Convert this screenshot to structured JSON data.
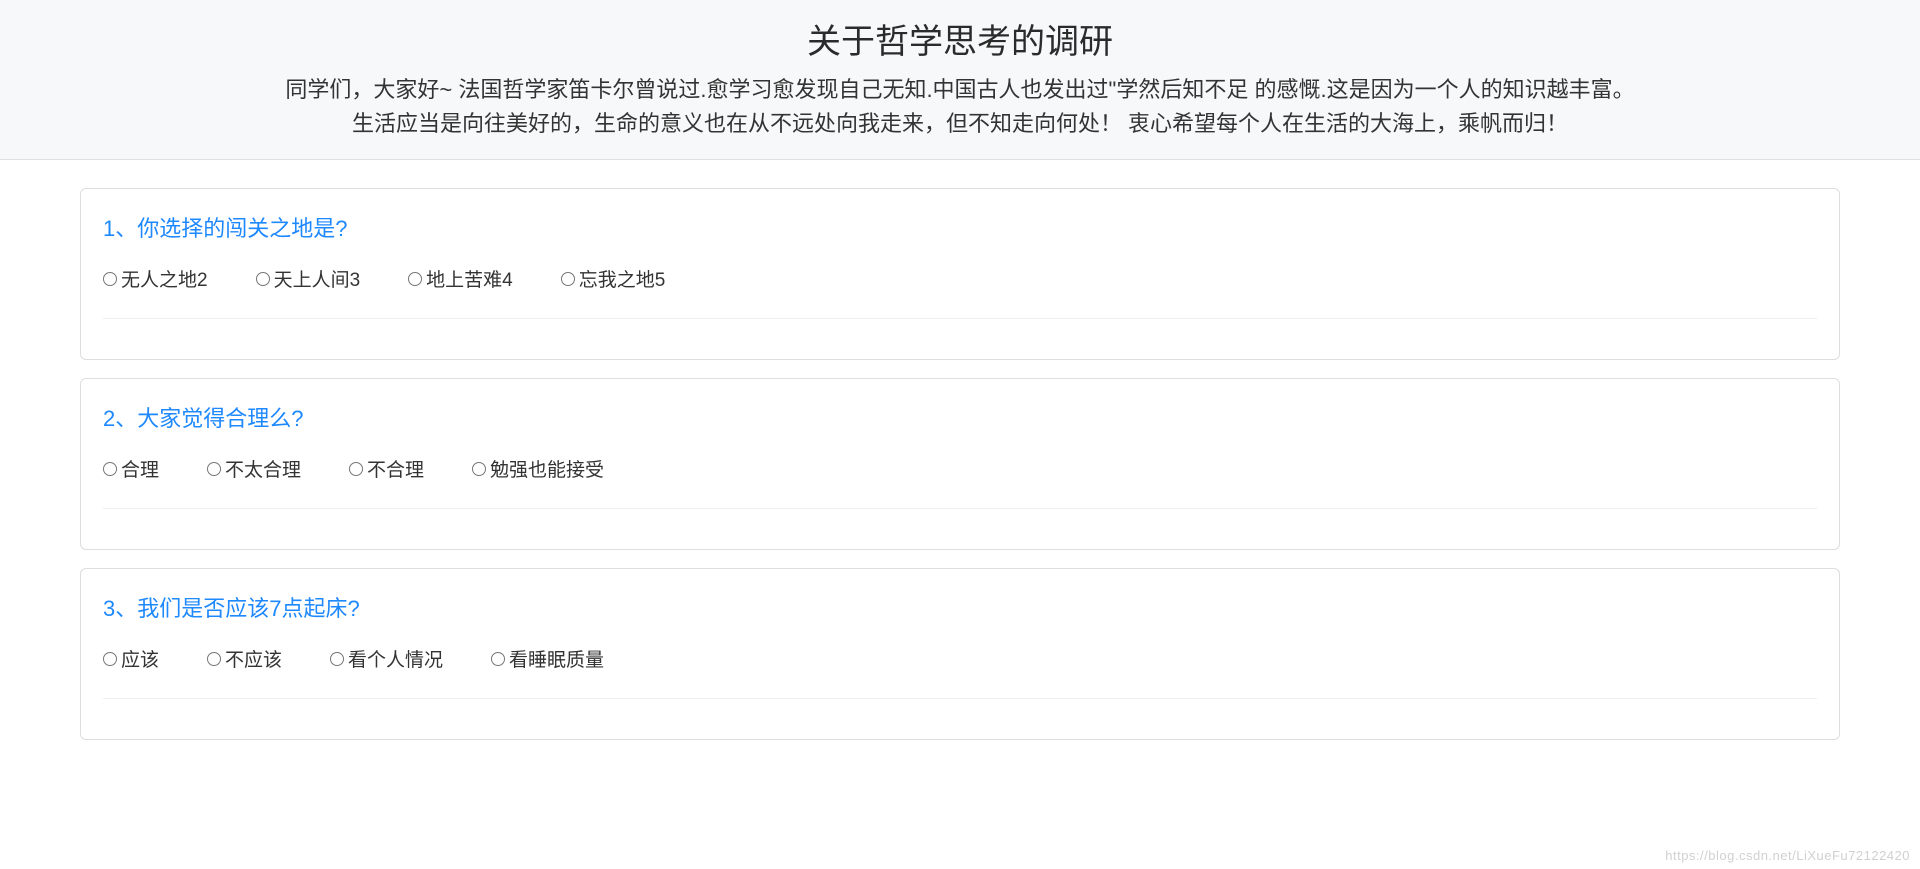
{
  "header": {
    "title": "关于哲学思考的调研",
    "description": "同学们，大家好~ 法国哲学家笛卡尔曾说过.愈学习愈发现自己无知.中国古人也发出过\"学然后知不足 的感慨.这是因为一个人的知识越丰富。 生活应当是向往美好的，生命的意义也在从不远处向我走来，但不知走向何处！ 衷心希望每个人在生活的大海上，乘帆而归！"
  },
  "questions": [
    {
      "title": "1、你选择的闯关之地是?",
      "options": [
        "无人之地2",
        "天上人间3",
        "地上苦难4",
        "忘我之地5"
      ]
    },
    {
      "title": "2、大家觉得合理么?",
      "options": [
        "合理",
        "不太合理",
        "不合理",
        "勉强也能接受"
      ]
    },
    {
      "title": "3、我们是否应该7点起床?",
      "options": [
        "应该",
        "不应该",
        "看个人情况",
        "看睡眠质量"
      ]
    }
  ],
  "watermark": "https://blog.csdn.net/LiXueFu72122420"
}
